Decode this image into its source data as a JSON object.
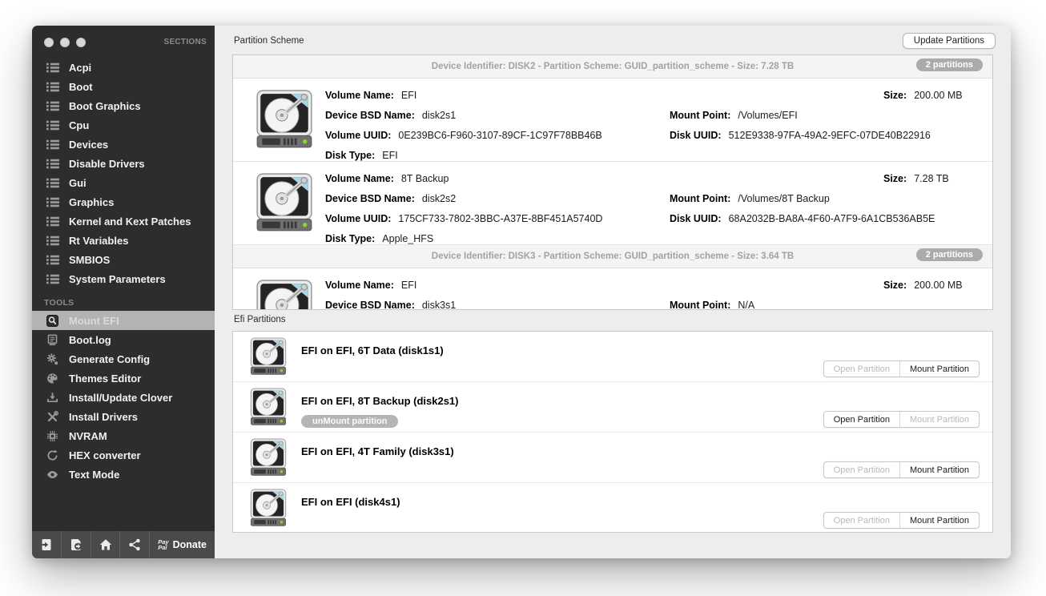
{
  "sidebar": {
    "sections_header": "SECTIONS",
    "sections": [
      "Acpi",
      "Boot",
      "Boot Graphics",
      "Cpu",
      "Devices",
      "Disable Drivers",
      "Gui",
      "Graphics",
      "Kernel and Kext Patches",
      "Rt Variables",
      "SMBIOS",
      "System Parameters"
    ],
    "tools_header": "TOOLS",
    "tools": [
      {
        "label": "Mount EFI",
        "icon": "mount-efi-icon",
        "selected": true
      },
      {
        "label": "Boot.log",
        "icon": "bootlog-icon",
        "selected": false
      },
      {
        "label": "Generate Config",
        "icon": "gear-icon",
        "selected": false
      },
      {
        "label": "Themes Editor",
        "icon": "palette-icon",
        "selected": false
      },
      {
        "label": "Install/Update Clover",
        "icon": "download-icon",
        "selected": false
      },
      {
        "label": "Install Drivers",
        "icon": "wrench-screwdriver-icon",
        "selected": false
      },
      {
        "label": "NVRAM",
        "icon": "chip-icon",
        "selected": false
      },
      {
        "label": "HEX converter",
        "icon": "circular-arrows-icon",
        "selected": false
      },
      {
        "label": "Text Mode",
        "icon": "eye-icon",
        "selected": false
      }
    ],
    "footer": {
      "icons": [
        "import-icon",
        "export-icon",
        "home-icon",
        "share-icon"
      ],
      "paypal_line1": "Pay",
      "paypal_line2": "Pal",
      "donate_label": "Donate"
    }
  },
  "main": {
    "partition_scheme": {
      "title": "Partition Scheme",
      "update_button_label": "Update Partitions",
      "field_labels": {
        "volume_name": "Volume Name:",
        "device_bsd_name": "Device BSD Name:",
        "volume_uuid": "Volume UUID:",
        "disk_type": "Disk Type:",
        "size": "Size:",
        "mount_point": "Mount Point:",
        "disk_uuid": "Disk UUID:"
      },
      "groups": [
        {
          "header": "Device Identifier: DISK2 - Partition Scheme: GUID_partition_scheme - Size: 7.28 TB",
          "badge": "2 partitions",
          "partitions": [
            {
              "volume_name": "EFI",
              "device_bsd_name": "disk2s1",
              "volume_uuid": "0E239BC6-F960-3107-89CF-1C97F78BB46B",
              "disk_type": "EFI",
              "size": "200.00 MB",
              "mount_point": "/Volumes/EFI",
              "disk_uuid": "512E9338-97FA-49A2-9EFC-07DE40B22916"
            },
            {
              "volume_name": "8T Backup",
              "device_bsd_name": "disk2s2",
              "volume_uuid": "175CF733-7802-3BBC-A37E-8BF451A5740D",
              "disk_type": "Apple_HFS",
              "size": "7.28 TB",
              "mount_point": "/Volumes/8T Backup",
              "disk_uuid": "68A2032B-BA8A-4F60-A7F9-6A1CB536AB5E"
            }
          ]
        },
        {
          "header": "Device Identifier: DISK3 - Partition Scheme: GUID_partition_scheme - Size: 3.64 TB",
          "badge": "2 partitions",
          "partitions": [
            {
              "volume_name": "EFI",
              "device_bsd_name": "disk3s1",
              "volume_uuid": "",
              "disk_type": "",
              "size": "200.00 MB",
              "mount_point": "N/A",
              "disk_uuid": ""
            }
          ]
        }
      ]
    },
    "efi_partitions": {
      "title": "Efi Partitions",
      "open_button_label": "Open Partition",
      "mount_button_label": "Mount Partition",
      "unmount_badge_label": "unMount partition",
      "rows": [
        {
          "title": "EFI on EFI, 6T Data (disk1s1)",
          "has_unmount_badge": false,
          "open_enabled": false,
          "mount_enabled": true
        },
        {
          "title": "EFI on EFI, 8T Backup (disk2s1)",
          "has_unmount_badge": true,
          "open_enabled": true,
          "mount_enabled": false
        },
        {
          "title": "EFI on EFI, 4T Family (disk3s1)",
          "has_unmount_badge": false,
          "open_enabled": false,
          "mount_enabled": true
        },
        {
          "title": "EFI on EFI (disk4s1)",
          "has_unmount_badge": false,
          "open_enabled": false,
          "mount_enabled": true
        }
      ]
    }
  },
  "colors": {
    "sidebar_bg": "#2d2d2d",
    "sidebar_selected_bg": "#b3b3b3",
    "footer_bg": "#4a4a4a",
    "badge_bg": "#ababab",
    "led_green": "#8ed338",
    "disk_cyan": "#a6d6e6"
  }
}
